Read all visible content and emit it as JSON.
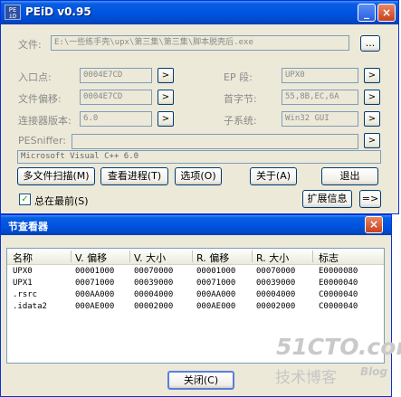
{
  "app": {
    "title": "PEiD v0.95",
    "icon_text": "PE iD",
    "controls": {
      "minimize": "_",
      "close": "×"
    }
  },
  "file": {
    "label": "文件:",
    "path": "E:\\一些练手壳\\upx\\第三集\\第三集\\脚本脱壳后.exe",
    "browse_label": "..."
  },
  "info": {
    "entry_point": {
      "label": "入口点:",
      "value": "0004E7CD"
    },
    "ep_section": {
      "label": "EP 段:",
      "value": "UPX0"
    },
    "file_offset": {
      "label": "文件偏移:",
      "value": "0004E7CD"
    },
    "first_bytes": {
      "label": "首字节:",
      "value": "55,8B,EC,6A"
    },
    "linker_version": {
      "label": "连接器版本:",
      "value": "6.0"
    },
    "subsystem": {
      "label": "子系统:",
      "value": "Win32 GUI"
    }
  },
  "pesniffer": {
    "label": "PESniffer:",
    "value": ""
  },
  "detection": "Microsoft Visual C++ 6.0",
  "arrow": ">",
  "buttons": {
    "multi_scan": "多文件扫描(M)",
    "view_process": "查看进程(T)",
    "options": "选项(O)",
    "about": "关于(A)",
    "exit": "退出",
    "extended_info": "扩展信息",
    "go": "=>"
  },
  "always_on_top": {
    "label": "总在最前(S)",
    "checked": true,
    "check_mark": "✓"
  },
  "section_viewer": {
    "title": "节查看器",
    "close_icon": "×",
    "columns": [
      "名称",
      "V. 偏移",
      "V. 大小",
      "R. 偏移",
      "R. 大小",
      "标志"
    ],
    "rows": [
      [
        "UPX0",
        "00001000",
        "00070000",
        "00001000",
        "00070000",
        "E0000080"
      ],
      [
        "UPX1",
        "00071000",
        "00039000",
        "00071000",
        "00039000",
        "E0000040"
      ],
      [
        ".rsrc",
        "000AA000",
        "00004000",
        "000AA000",
        "00004000",
        "C0000040"
      ],
      [
        ".idata2",
        "000AE000",
        "00002000",
        "000AE000",
        "00002000",
        "C0000040"
      ]
    ],
    "close_button": "关闭(C)"
  },
  "watermark": {
    "site": "51CTO.com",
    "tagline": "技术博客",
    "blog": "Blog"
  }
}
